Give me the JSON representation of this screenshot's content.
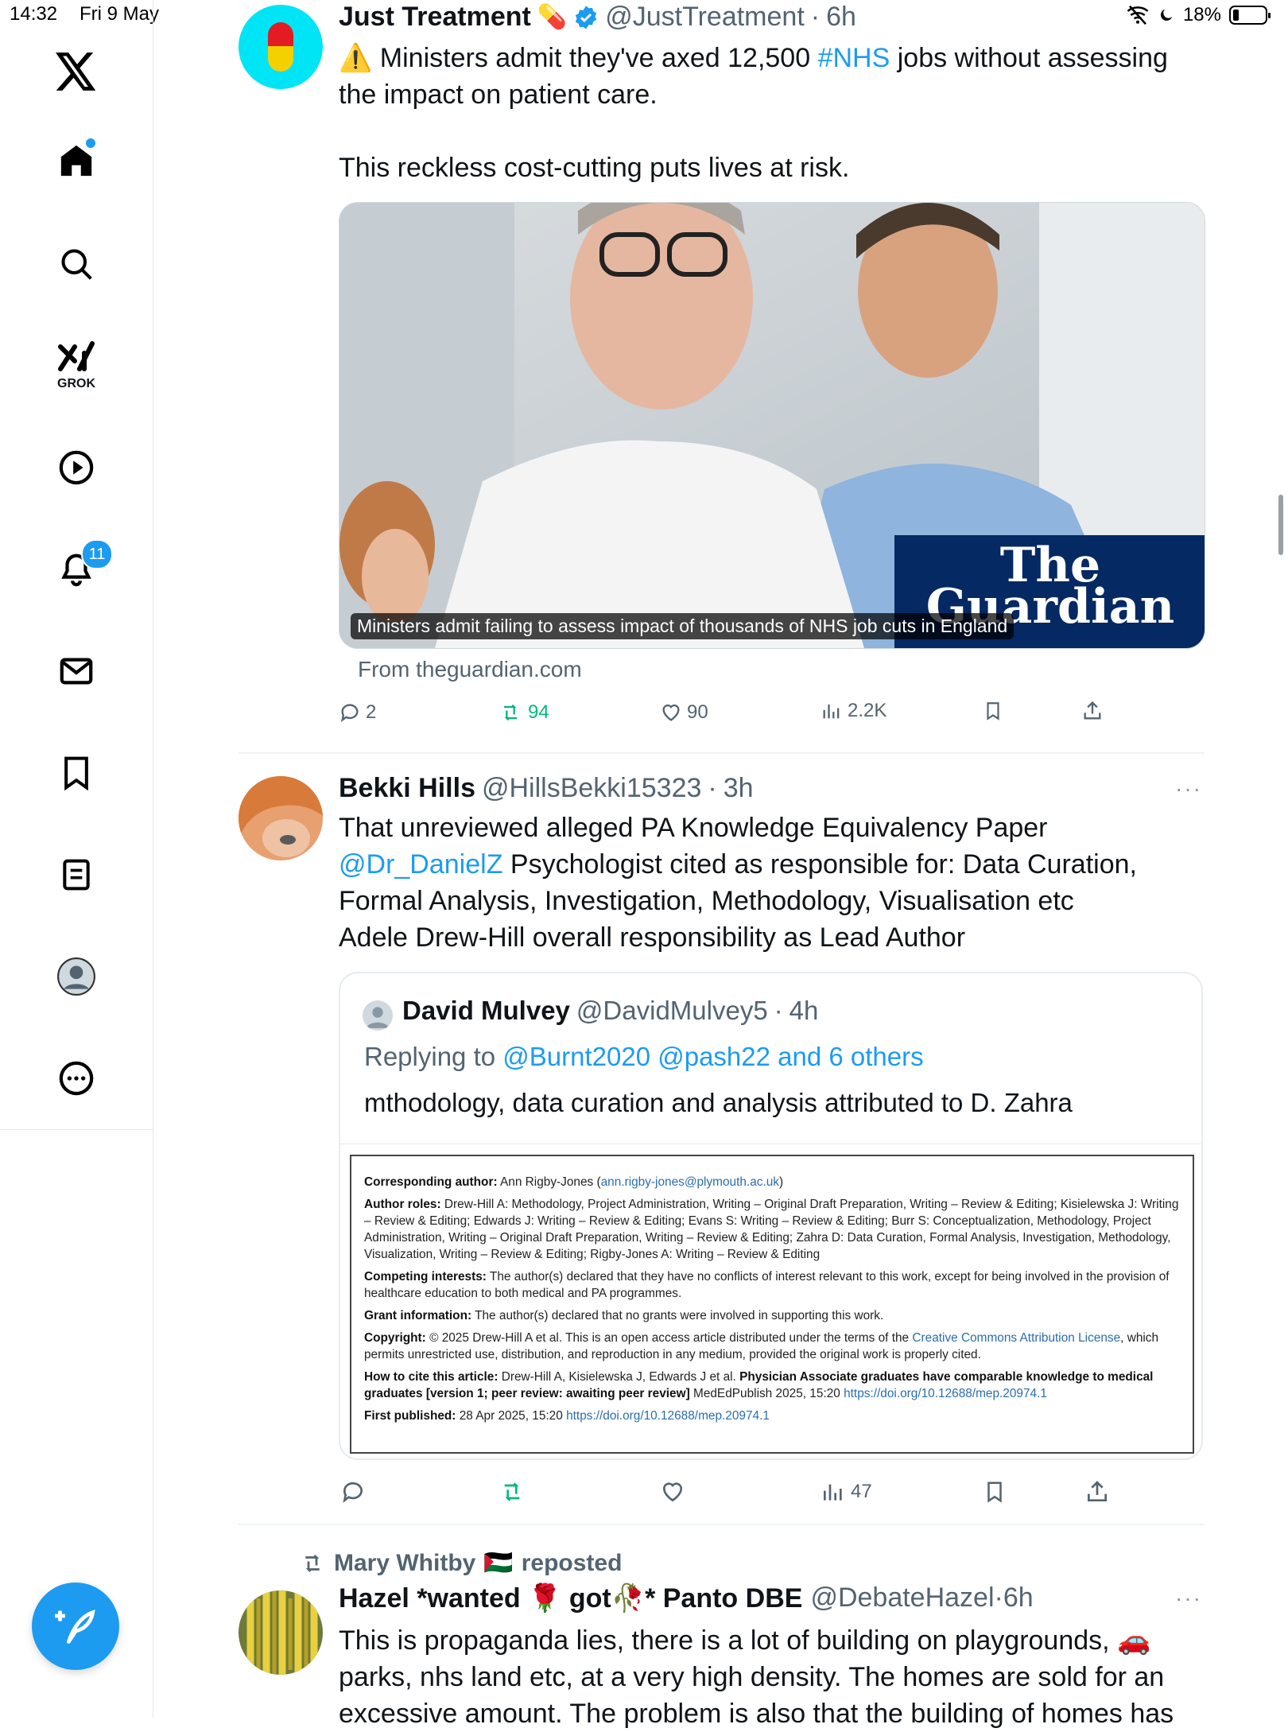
{
  "status": {
    "time": "14:32",
    "date": "Fri 9 May",
    "battery": "18%",
    "battery_level": 0.18
  },
  "sidebar": {
    "logo": "x-logo",
    "grok_label": "GROK",
    "notifications_badge": "11"
  },
  "tweet1": {
    "name": "Just Treatment",
    "name_emoji": "💊",
    "handle": "@JustTreatment",
    "sep": "·",
    "time": "6h",
    "line1_warn": "⚠️",
    "line1_a": "Ministers admit they've axed 12,500 ",
    "line1_tag": "#NHS",
    "line1_b": " jobs without assessing",
    "line2": "the impact on patient care.",
    "line3": "This reckless cost-cutting puts lives at risk.",
    "card_caption": "Ministers admit failing to assess impact of thousands of NHS job cuts in England",
    "card_logo_line1": "The",
    "card_logo_line2": "Guardian",
    "card_source": "From theguardian.com",
    "replies": "2",
    "reposts": "94",
    "likes": "90",
    "views": "2.2K"
  },
  "tweet2": {
    "name": "Bekki Hills",
    "handle": "@HillsBekki15323",
    "sep": "·",
    "time": "3h",
    "more": "···",
    "line1": "That unreviewed alleged PA Knowledge Equivalency Paper",
    "line2_mention": "@Dr_DanielZ",
    "line2_rest": " Psychologist   cited as responsible for: Data Curation,",
    "line3": "Formal Analysis, Investigation, Methodology, Visualisation etc",
    "line4": "Adele Drew-Hill overall responsibility as Lead Author",
    "views": "47",
    "quote": {
      "name": "David Mulvey",
      "handle": "@DavidMulvey5",
      "sep": "·",
      "time": "4h",
      "replying_prefix": "Replying to ",
      "replying_targets": "@Burnt2020 @pash22 and 6 others",
      "text": "mthodology, data curation and analysis attributed to D. Zahra",
      "doc": {
        "corr_label": "Corresponding author:",
        "corr_value": " Ann Rigby-Jones (",
        "corr_email": "ann.rigby-jones@plymouth.ac.uk",
        "corr_close": ")",
        "roles_label": "Author roles:",
        "roles_text": " Drew-Hill A: Methodology, Project Administration, Writing – Original Draft Preparation, Writing – Review & Editing; Kisielewska J: Writing – Review & Editing; Edwards J: Writing – Review & Editing; Evans S: Writing – Review & Editing; Burr S: Conceptualization, Methodology, Project Administration, Writing – Original Draft Preparation, Writing – Review & Editing; Zahra D: Data Curation, Formal Analysis, Investigation, Methodology, Visualization, Writing – Review & Editing; Rigby-Jones A: Writing – Review & Editing",
        "ci_label": "Competing interests:",
        "ci_text": " The author(s) declared that they have no conflicts of interest relevant to this work, except for being involved in the provision of healthcare education to both medical and PA programmes.",
        "grant_label": "Grant information:",
        "grant_text": " The author(s) declared that no grants were involved in supporting this work.",
        "copy_label": "Copyright:",
        "copy_text": " © 2025 Drew-Hill A et al. This is an open access article distributed under the terms of the ",
        "copy_link": "Creative Commons Attribution License",
        "copy_tail": ", which permits unrestricted use, distribution, and reproduction in any medium, provided the original work is properly cited.",
        "cite_label": "How to cite this article:",
        "cite_text": " Drew-Hill A, Kisielewska J, Edwards J et al. ",
        "cite_bold": "Physician Associate graduates have comparable knowledge to medical graduates [version 1; peer review: awaiting peer review]",
        "cite_tail": " MedEdPublish 2025, 15:20 ",
        "cite_doi": "https://doi.org/10.12688/mep.20974.1",
        "first_label": "First published:",
        "first_text": " 28 Apr 2025, 15:20 ",
        "first_doi": "https://doi.org/10.12688/mep.20974.1"
      }
    }
  },
  "tweet3": {
    "reposter": "Mary Whitby",
    "reposter_flag": "🇵🇸",
    "reposted_label": "reposted",
    "name_a": "Hazel *wanted ",
    "name_rose": "🌹",
    "name_b": " got",
    "name_wilted": "🥀",
    "name_c": "* Panto DBE",
    "handle": "@DebateHazel",
    "sep": "·",
    "time": "6h",
    "more": "···",
    "line1": "This is propaganda lies, there is a lot of building on playgrounds, 🚗",
    "line2": "parks, nhs land etc, at a very high density. The homes are sold for an",
    "line3": "excessive amount. The problem is also that the building of homes has"
  },
  "colors": {
    "accent": "#1d9bf0",
    "repost_green": "#00ba7c",
    "muted": "#536471",
    "guardian_blue": "#052962"
  }
}
